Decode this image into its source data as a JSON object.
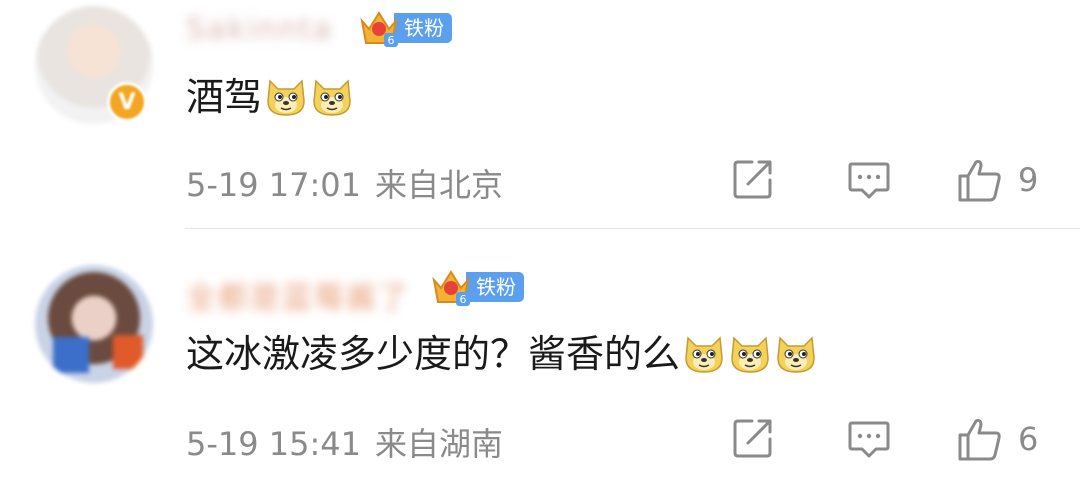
{
  "comments": [
    {
      "username": "Sakinnta",
      "fan_badge": {
        "level": "6",
        "label": "铁粉"
      },
      "text": "酒驾",
      "emoji_count": 2,
      "time": "5-19 17:01",
      "location": "来自北京",
      "likes": "9",
      "verified_mark": "V"
    },
    {
      "username": "全都是蓝莓酱了",
      "fan_badge": {
        "level": "6",
        "label": "铁粉"
      },
      "text": "这冰激凌多少度的？酱香的么",
      "emoji_count": 3,
      "time": "5-19 15:41",
      "location": "来自湖南",
      "likes": "6"
    }
  ],
  "icons": {
    "share": "share-icon",
    "comment": "comment-icon",
    "like": "thumbs-up-icon",
    "emoji": "doge-emoji-icon",
    "crown": "crown-badge-icon"
  },
  "colors": {
    "fan_badge": "#5aa0ef",
    "meta_text": "#8a8a8a",
    "verified": "#f3a623"
  }
}
